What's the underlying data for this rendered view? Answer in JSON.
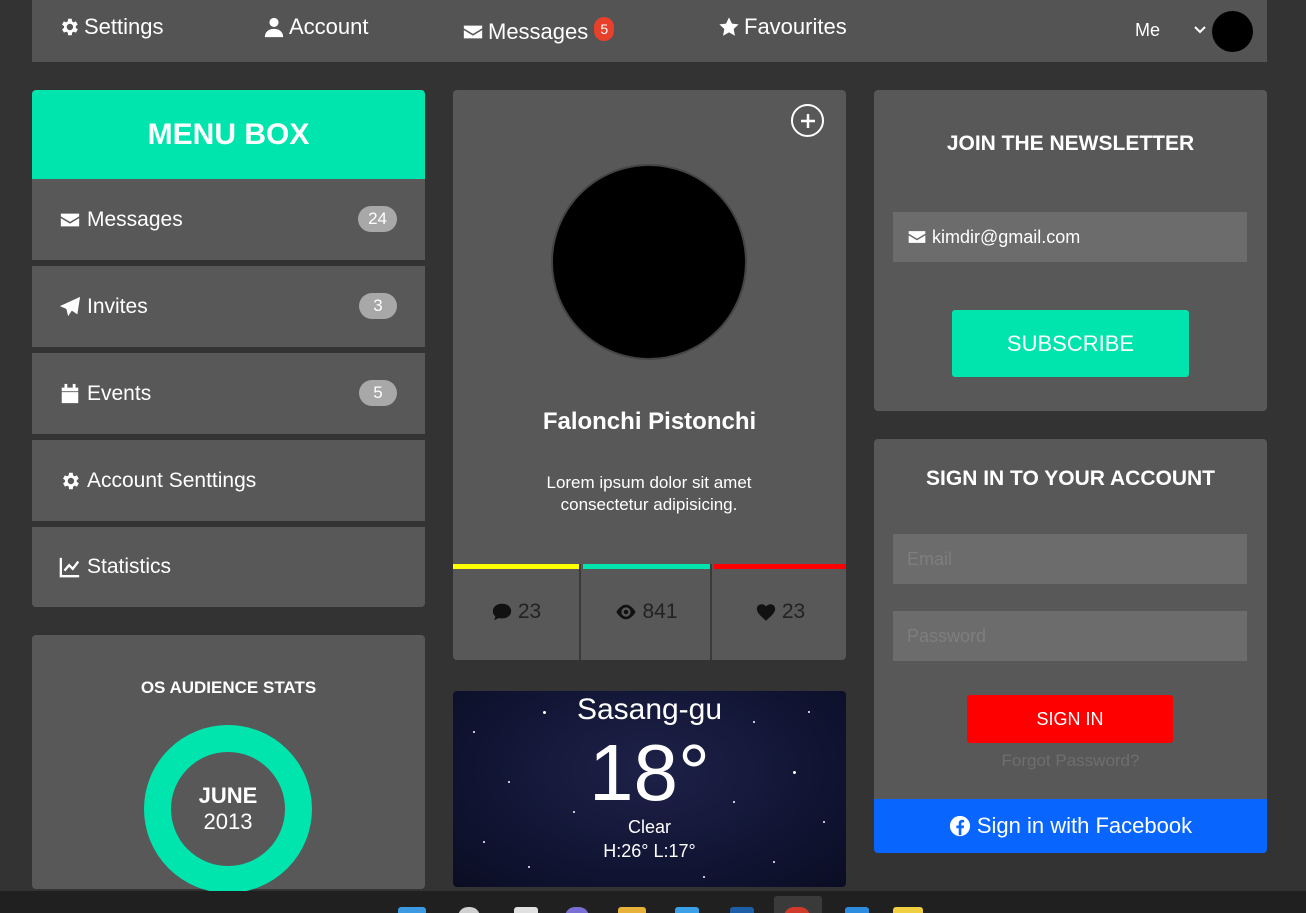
{
  "nav": {
    "settings": "Settings",
    "account": "Account",
    "messages": "Messages",
    "messages_badge": "5",
    "favourites": "Favourites",
    "user": "Me"
  },
  "menu": {
    "title": "MENU BOX",
    "items": [
      {
        "label": "Messages",
        "count": "24",
        "icon": "envelope-icon"
      },
      {
        "label": "Invites",
        "count": "3",
        "icon": "paper-plane-icon"
      },
      {
        "label": "Events",
        "count": "5",
        "icon": "calendar-icon"
      },
      {
        "label": "Account Senttings",
        "count": "",
        "icon": "gear-icon"
      },
      {
        "label": "Statistics",
        "count": "",
        "icon": "line-chart-icon"
      }
    ]
  },
  "stats": {
    "title": "OS AUDIENCE STATS",
    "month": "JUNE",
    "year": "2013"
  },
  "profile": {
    "name": "Falonchi Pistonchi",
    "bio": "Lorem ipsum dolor sit amet consectetur adipisicing.",
    "comments": "23",
    "views": "841",
    "likes": "23"
  },
  "weather": {
    "city": "Sasang-gu",
    "temp": "18°",
    "condition": "Clear",
    "highlow": "H:26°  L:17°"
  },
  "newsletter": {
    "title": "JOIN THE NEWSLETTER",
    "email": "kimdir@gmail.com",
    "subscribe": "SUBSCRIBE"
  },
  "signin": {
    "title": "SIGN IN TO YOUR ACCOUNT",
    "username_placeholder": "Email",
    "password_placeholder": "Password",
    "button": "SIGN IN",
    "forgot": "Forgot Password?",
    "facebook": "Sign in with Facebook"
  },
  "colors": {
    "accent": "#00e4ad",
    "danger": "#ff0000",
    "facebook": "#0866ff",
    "bar_yellow": "#ffff00",
    "bar_red": "#ff0000"
  }
}
